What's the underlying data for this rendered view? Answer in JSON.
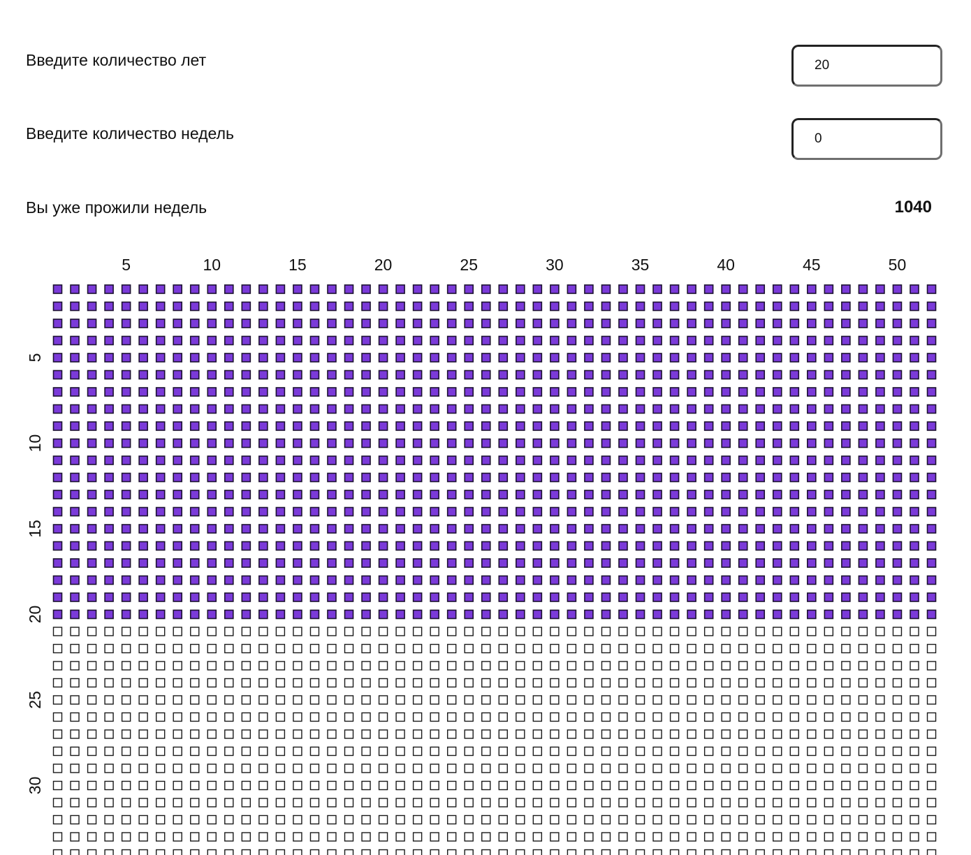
{
  "form": {
    "years": {
      "label": "Введите количество лет",
      "value": "20"
    },
    "weeks": {
      "label": "Введите количество недель",
      "value": "0"
    }
  },
  "result": {
    "label": "Вы уже прожили недель",
    "value": "1040"
  },
  "grid": {
    "weeks_per_row": 52,
    "visible_rows": 34,
    "lived_weeks": 1040,
    "column_labels": [
      "5",
      "10",
      "15",
      "20",
      "25",
      "30",
      "35",
      "40",
      "45",
      "50"
    ],
    "row_labels": [
      "5",
      "10",
      "15",
      "20",
      "25",
      "30"
    ],
    "colors": {
      "lived_fill": "#7b3ad9",
      "lived_border": "#1c1130",
      "future_fill": "#ffffff",
      "future_border": "#1a1a1a"
    }
  }
}
